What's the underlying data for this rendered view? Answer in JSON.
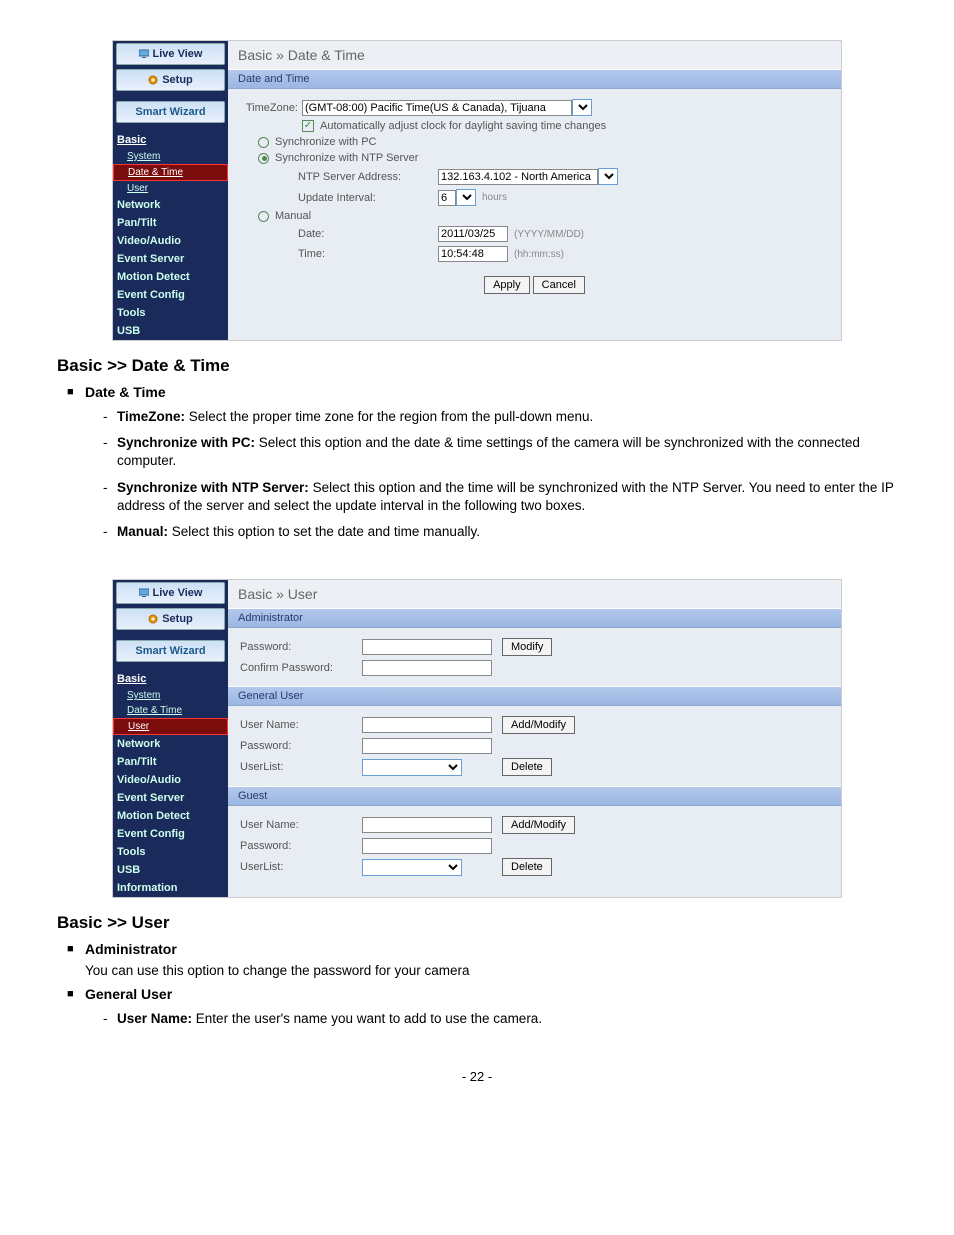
{
  "nav": {
    "live_view": "Live View",
    "setup": "Setup",
    "smart_wizard": "Smart Wizard"
  },
  "sidebar": {
    "basic": "Basic",
    "system": "System",
    "date_time": "Date & Time",
    "user": "User",
    "network": "Network",
    "pan_tilt": "Pan/Tilt",
    "video_audio": "Video/Audio",
    "event_server": "Event Server",
    "motion_detect": "Motion Detect",
    "event_config": "Event Config",
    "tools": "Tools",
    "usb": "USB",
    "information": "Information"
  },
  "screenshot1": {
    "breadcrumb": "Basic » Date & Time",
    "section": "Date and Time",
    "timezone_label": "TimeZone:",
    "timezone_value": "(GMT-08:00) Pacific Time(US & Canada), Tijuana",
    "daylight": "Automatically adjust clock for daylight saving time changes",
    "sync_pc": "Synchronize with PC",
    "sync_ntp": "Synchronize with NTP Server",
    "ntp_addr_label": "NTP Server Address:",
    "ntp_addr_value": "132.163.4.102 - North America",
    "update_interval_label": "Update Interval:",
    "update_interval_value": "6",
    "hours": "hours",
    "manual": "Manual",
    "date_label": "Date:",
    "date_value": "2011/03/25",
    "date_hint": "(YYYY/MM/DD)",
    "time_label": "Time:",
    "time_value": "10:54:48",
    "time_hint": "(hh:mm:ss)",
    "apply": "Apply",
    "cancel": "Cancel"
  },
  "doc1": {
    "heading": "Basic >> Date & Time",
    "sub": "Date & Time",
    "li1_term": "TimeZone: ",
    "li1_text": "Select the proper time zone for the region from the pull-down menu.",
    "li2_term": "Synchronize with PC: ",
    "li2_text": "Select this option and the date & time settings of the camera will be synchronized with the connected computer.",
    "li3_term": "Synchronize with NTP Server: ",
    "li3_text": "Select this option and the time will be synchronized with the NTP Server. You need to enter the IP address of the server and select the update interval in the following two boxes.",
    "li4_term": "Manual: ",
    "li4_text": "Select this option to set the date and time manually."
  },
  "screenshot2": {
    "breadcrumb": "Basic » User",
    "admin_hdr": "Administrator",
    "password": "Password:",
    "confirm_password": "Confirm Password:",
    "modify": "Modify",
    "general_hdr": "General User",
    "username": "User Name:",
    "userlist": "UserList:",
    "add_modify": "Add/Modify",
    "delete": "Delete",
    "guest_hdr": "Guest"
  },
  "doc2": {
    "heading": "Basic >> User",
    "sub1": "Administrator",
    "p1": "You can use this option to change the password for your camera",
    "sub2": "General User",
    "li1_term": "User Name: ",
    "li1_text": "Enter the user's name you want to add to use the camera."
  },
  "page_number": "- 22 -"
}
